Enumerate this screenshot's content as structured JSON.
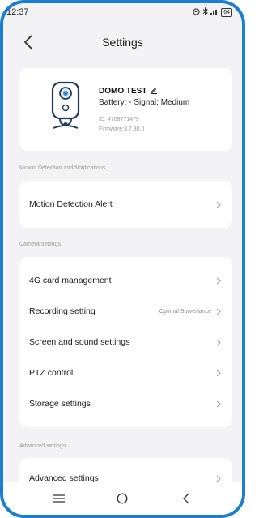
{
  "status_bar": {
    "time": "12:37",
    "battery": "64"
  },
  "header": {
    "title": "Settings"
  },
  "device": {
    "name": "DOMO TEST",
    "status": "Battery:  - Signal:  Medium",
    "id": "ID: 4709771479",
    "firmware": "Firmware:3.7.30.0"
  },
  "sections": {
    "motion": {
      "label": "Motion Detection and Notifications",
      "items": [
        {
          "label": "Motion Detection Alert",
          "value": ""
        }
      ]
    },
    "camera": {
      "label": "Camera settings",
      "items": [
        {
          "label": "4G card management",
          "value": ""
        },
        {
          "label": "Recording setting",
          "value": "Optimal Surveillance"
        },
        {
          "label": "Screen and sound settings",
          "value": ""
        },
        {
          "label": "PTZ control",
          "value": ""
        },
        {
          "label": "Storage settings",
          "value": ""
        }
      ]
    },
    "advanced": {
      "label": "Advanced settings",
      "items": [
        {
          "label": "Advanced settings",
          "value": ""
        }
      ]
    }
  },
  "colors": {
    "frame": "#1a7fd0",
    "background": "#f3f3f5",
    "card": "#ffffff"
  }
}
